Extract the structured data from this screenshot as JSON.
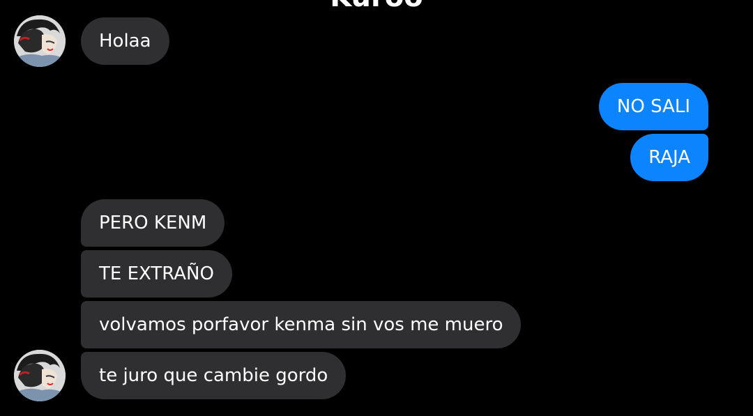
{
  "header": {
    "contact_name": "Kuroo"
  },
  "avatar": {
    "icon": "contact-avatar-image"
  },
  "messages": [
    {
      "direction": "incoming",
      "text": "Holaa"
    },
    {
      "direction": "outgoing",
      "text": "NO SALI"
    },
    {
      "direction": "outgoing",
      "text": "RAJA"
    },
    {
      "direction": "incoming",
      "text": "PERO KENM"
    },
    {
      "direction": "incoming",
      "text": "TE EXTRAÑO"
    },
    {
      "direction": "incoming",
      "text": "volvamos porfavor kenma sin vos me muero"
    },
    {
      "direction": "incoming",
      "text": "te juro que cambie gordo"
    }
  ],
  "colors": {
    "background": "#000000",
    "incoming_bubble": "#2f2f31",
    "outgoing_bubble": "#0b84fe",
    "text": "#ffffff"
  }
}
